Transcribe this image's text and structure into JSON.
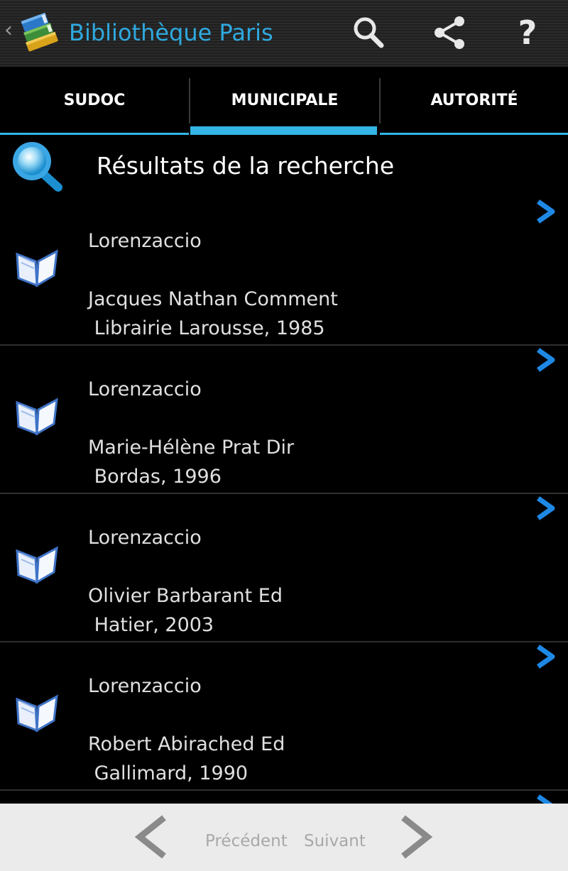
{
  "actionbar": {
    "title": "Bibliothèque Paris",
    "up_icon": "chevron-left-icon",
    "actions": [
      "search-icon",
      "share-icon",
      "help-icon"
    ],
    "help_glyph": "?"
  },
  "tabs": [
    {
      "label": "SUDOC",
      "selected": false
    },
    {
      "label": "MUNICIPALE",
      "selected": true
    },
    {
      "label": "AUTORITÉ",
      "selected": false
    }
  ],
  "header": {
    "title": "Résultats de la recherche",
    "icon": "magnifier-icon"
  },
  "results": [
    {
      "title": "Lorenzaccio",
      "author": "Jacques Nathan Comment",
      "publisher": " Librairie Larousse, 1985"
    },
    {
      "title": "Lorenzaccio",
      "author": "Marie-Hélène Prat Dir",
      "publisher": " Bordas, 1996"
    },
    {
      "title": "Lorenzaccio",
      "author": "Olivier Barbarant Ed",
      "publisher": " Hatier, 2003"
    },
    {
      "title": "Lorenzaccio",
      "author": "Robert Abirached Ed",
      "publisher": " Gallimard, 1990"
    }
  ],
  "pagination": {
    "previous_label": "Précédent",
    "next_label": "Suivant"
  },
  "colors": {
    "accent": "#33b5e5",
    "title": "#2fa9df",
    "arrow": "#1e88e5"
  }
}
